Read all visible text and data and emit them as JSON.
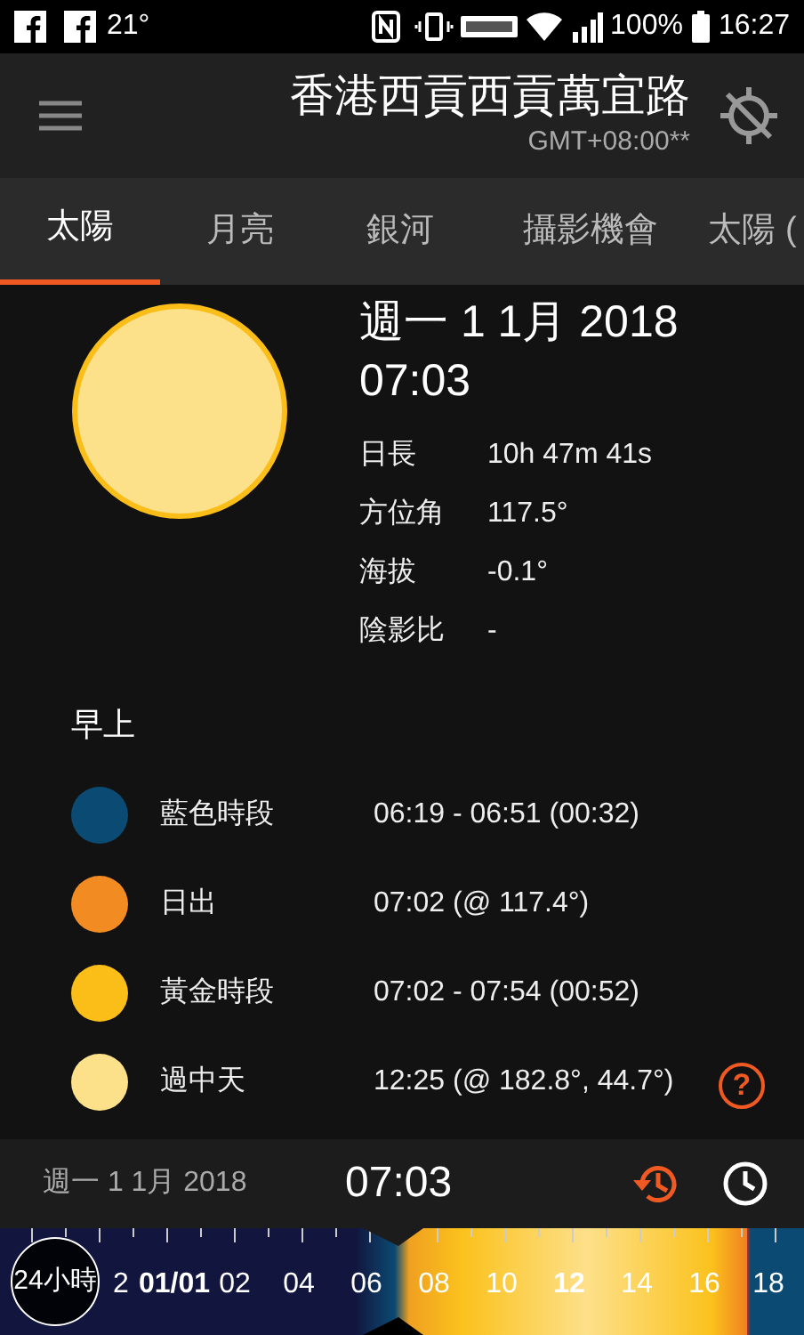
{
  "status_bar": {
    "left": [
      "21°"
    ],
    "battery": "100%",
    "time": "16:27"
  },
  "header": {
    "title": "香港西貢西貢萬宜路",
    "timezone": "GMT+08:00**"
  },
  "tabs": [
    {
      "label": "太陽",
      "selected": true
    },
    {
      "label": "月亮",
      "selected": false
    },
    {
      "label": "銀河",
      "selected": false
    },
    {
      "label": "攝影機會",
      "selected": false
    },
    {
      "label": "太陽 (",
      "selected": false
    }
  ],
  "summary": {
    "date": "週一 1 1月 2018",
    "time": "07:03",
    "details": [
      {
        "label": "日長",
        "value": "10h 47m 41s"
      },
      {
        "label": "方位角",
        "value": "117.5°"
      },
      {
        "label": "海拔",
        "value": "-0.1°"
      },
      {
        "label": "陰影比",
        "value": "-"
      }
    ]
  },
  "section_title": "早上",
  "events": [
    {
      "name": "藍色時段",
      "value": "06:19 - 06:51  (00:32)",
      "color": "#0b4a73"
    },
    {
      "name": "日出",
      "value": "07:02 (@ 117.4°)",
      "color": "#f28b22"
    },
    {
      "name": "黃金時段",
      "value": "07:02 - 07:54  (00:52)",
      "color": "#fbbd18"
    },
    {
      "name": "過中天",
      "value": "12:25 (@ 182.8°, 44.7°)",
      "color": "#fde08a"
    }
  ],
  "help": "?",
  "bottom_bar": {
    "date": "週一 1 1月 2018",
    "time": "07:03"
  },
  "timeline": {
    "mode_button": "24小時",
    "labels": [
      {
        "text": "2",
        "bold": false
      },
      {
        "text": "01/01",
        "bold": true
      },
      {
        "text": "02",
        "bold": false
      },
      {
        "text": "04",
        "bold": false
      },
      {
        "text": "06",
        "bold": false
      },
      {
        "text": "08",
        "bold": false
      },
      {
        "text": "10",
        "bold": false
      },
      {
        "text": "12",
        "bold": true
      },
      {
        "text": "14",
        "bold": false
      },
      {
        "text": "16",
        "bold": false
      },
      {
        "text": "18",
        "bold": false
      }
    ]
  }
}
